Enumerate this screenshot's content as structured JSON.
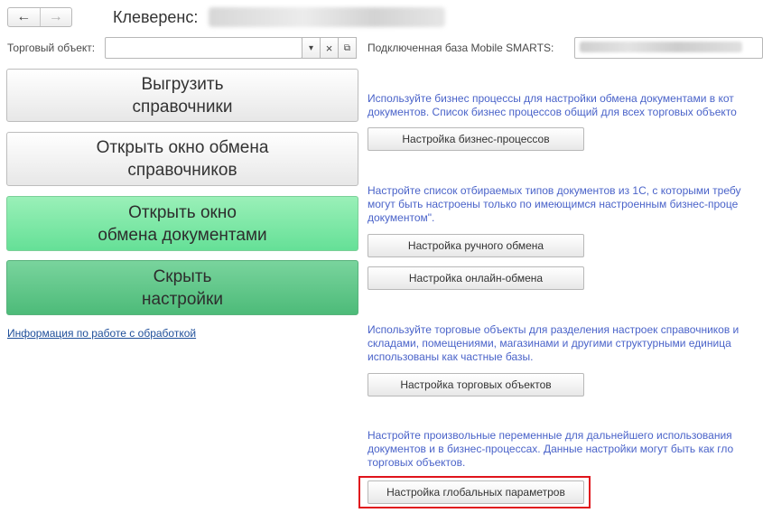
{
  "nav": {
    "back_icon": "←",
    "forward_icon": "→"
  },
  "header": {
    "title": "Клеверенс:"
  },
  "trade_object": {
    "label": "Торговый объект:",
    "value": "",
    "dropdown_icon": "▾",
    "clear_icon": "×",
    "open_icon": "⧉"
  },
  "mobile_base": {
    "label": "Подключенная база Mobile SMARTS:"
  },
  "left_buttons": [
    {
      "label": "Выгрузить\nсправочники"
    },
    {
      "label": "Открыть окно обмена\nсправочников"
    },
    {
      "label": "Открыть окно\nобмена документами"
    },
    {
      "label": "Скрыть\nнастройки"
    }
  ],
  "info_link": "Информация по работе с обработкой",
  "sections": [
    {
      "hint": "Используйте бизнес процессы для настройки обмена документами в кот\nдокументов. Список бизнес процессов общий для всех торговых объекто"
    },
    {
      "hint": "Настройте список отбираемых типов документов из 1С, с которыми требу\nмогут быть настроены только по имеющимся настроенным бизнес-проце\nдокументом\"."
    },
    {
      "hint": "Используйте торговые объекты для разделения настроек справочников и\nскладами, помещениями, магазинами и другими структурными единица\nиспользованы как частные базы."
    },
    {
      "hint": "Настройте произвольные переменные для дальнейшего использования\nдокументов и в бизнес-процессах. Данные настройки могут быть как гло\nторговых объектов."
    }
  ],
  "buttons": {
    "business_processes": "Настройка бизнес-процессов",
    "manual_exchange": "Настройка ручного обмена",
    "online_exchange": "Настройка онлайн-обмена",
    "trade_objects": "Настройка торговых объектов",
    "global_params": "Настройка глобальных параметров"
  },
  "colors": {
    "hint_text": "#4a63c9",
    "link": "#1f4f9a",
    "green_light": "#65e097",
    "green_dark": "#4dbb79",
    "highlight": "#e0141c"
  }
}
